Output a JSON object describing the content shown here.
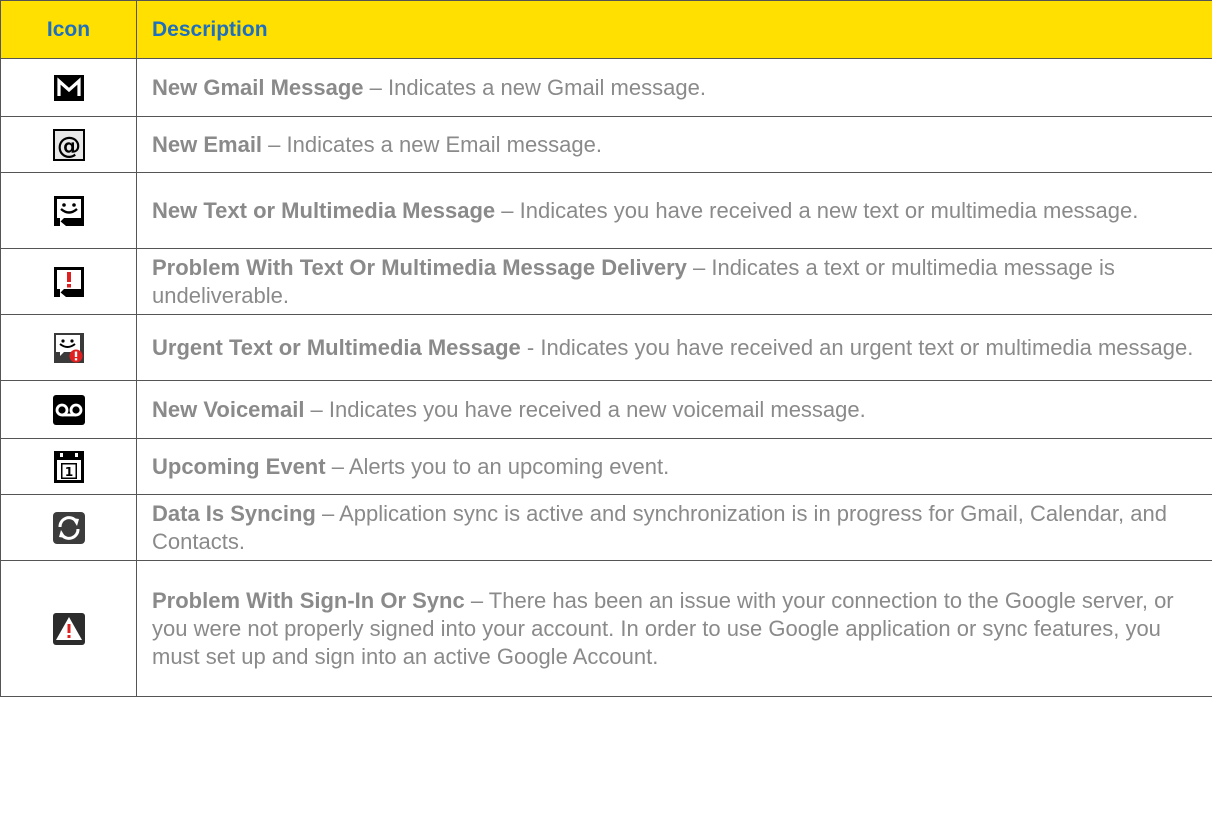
{
  "header": {
    "icon_col": "Icon",
    "desc_col": "Description"
  },
  "rows": [
    {
      "icon": "gmail-icon",
      "title": "New Gmail Message",
      "sep": " – ",
      "text": "Indicates a new Gmail message."
    },
    {
      "icon": "email-at-icon",
      "title": "New Email",
      "sep": " – ",
      "text": "Indicates a new Email message."
    },
    {
      "icon": "text-message-icon",
      "title": "New Text or Multimedia Message",
      "sep": " – ",
      "text": "Indicates you have received a new text or multimedia message."
    },
    {
      "icon": "message-problem-icon",
      "title": "Problem With Text Or Multimedia Message Delivery",
      "sep": " – ",
      "text": "Indicates a text or multimedia message is undeliverable."
    },
    {
      "icon": "urgent-message-icon",
      "title": "Urgent Text or Multimedia Message",
      "sep": " - ",
      "text": "Indicates you have received an urgent text or multimedia message."
    },
    {
      "icon": "voicemail-icon",
      "title": "New Voicemail",
      "sep": " – ",
      "text": "Indicates you have received a new voicemail message."
    },
    {
      "icon": "calendar-event-icon",
      "title": "Upcoming Event",
      "sep": " – ",
      "text": "Alerts you to an upcoming event."
    },
    {
      "icon": "sync-icon",
      "title": "Data Is Syncing",
      "sep": " – ",
      "text": "Application sync is active and synchronization is in progress for Gmail, Calendar, and Contacts."
    },
    {
      "icon": "warning-triangle-icon",
      "title": "Problem With Sign-In Or Sync",
      "sep": " – ",
      "text": "There has been an issue with your connection to the Google server, or you were not properly signed into your account. In order to use Google application or sync features, you must set up and sign into an active Google Account."
    }
  ],
  "colors": {
    "header_bg": "#ffe000",
    "header_text": "#1f6fbf",
    "body_text": "#8a8a8a"
  }
}
